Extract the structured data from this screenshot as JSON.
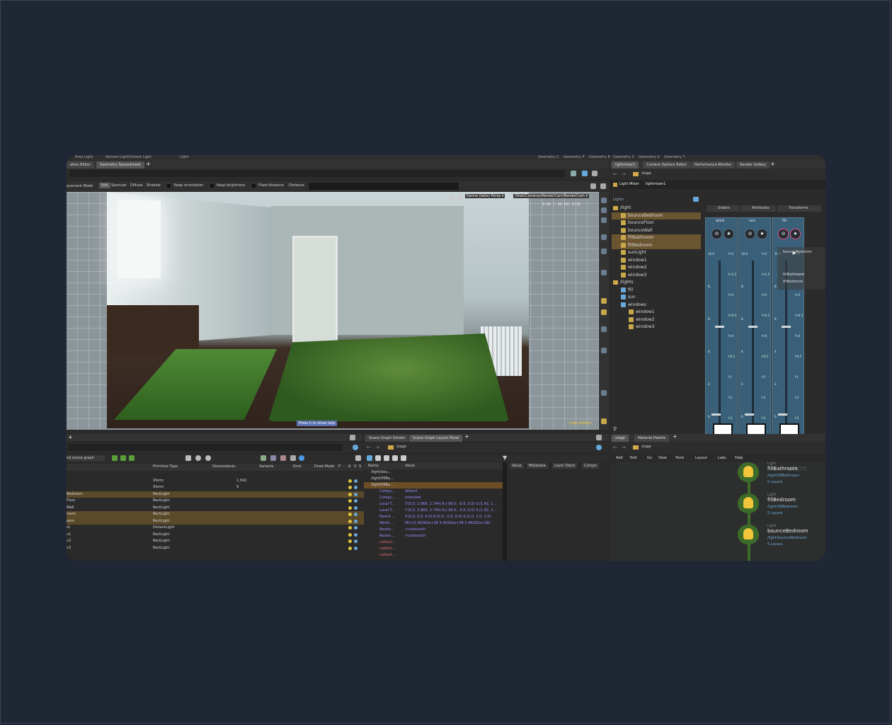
{
  "top_tabs": {
    "left_row": [
      "Area Light",
      "Volume Light",
      "Distant Light",
      "Light"
    ],
    "right_row": [
      "Geometry C",
      "Geometry P",
      "Geometry R",
      "Geometry S",
      "Geometry S",
      "Geometry T"
    ]
  },
  "pane_tabs_left": [
    "ation Editor",
    "Geometry Spreadsheet"
  ],
  "pane_tabs_right": [
    "lightmixer1",
    "Content Options Editor",
    "Performance Monitor",
    "Render Gallery"
  ],
  "viewport": {
    "mode_label": "acement Mode",
    "buttons": [
      "Edit",
      "Specular",
      "Diffuse",
      "Shadow"
    ],
    "checks": [
      "Keep orientation",
      "Keep brightness",
      "Fixed distance",
      "Distance"
    ],
    "renderer": "Karma (beta) Persp ▾",
    "camera_path": "/Shot/Cameras/RenderCam/RenderCam ▾",
    "stats": "0.8%   (-34:19)   0:16",
    "help_hint": "Press h to show help",
    "edition": "Indie Edition"
  },
  "light_mixer": {
    "path": "stage",
    "header": "Light Mixer",
    "node_name": "lightmixer1",
    "lights_label": "Lights",
    "tabs": [
      "Sliders",
      "Attributes",
      "Transforms"
    ],
    "tree": [
      {
        "label": "/light",
        "type": "folder",
        "level": 0
      },
      {
        "label": "bounceBedroom",
        "type": "light",
        "level": 1,
        "selected": true
      },
      {
        "label": "bounceFloor",
        "type": "light",
        "level": 1
      },
      {
        "label": "bounceWall",
        "type": "light",
        "level": 1
      },
      {
        "label": "fillBathroom",
        "type": "light",
        "level": 1,
        "selected": true
      },
      {
        "label": "fillBedroom",
        "type": "light",
        "level": 1,
        "selected": true
      },
      {
        "label": "sunLight",
        "type": "light",
        "level": 1
      },
      {
        "label": "window1",
        "type": "light",
        "level": 1
      },
      {
        "label": "window2",
        "type": "light",
        "level": 1
      },
      {
        "label": "window3",
        "type": "light",
        "level": 1
      },
      {
        "label": "/lights",
        "type": "folder",
        "level": 0
      },
      {
        "label": "fill",
        "type": "group",
        "level": 1
      },
      {
        "label": "sun",
        "type": "group",
        "level": 1
      },
      {
        "label": "windows",
        "type": "group",
        "level": 1
      },
      {
        "label": "window1",
        "type": "light",
        "level": 2
      },
      {
        "label": "window2",
        "type": "light",
        "level": 2
      },
      {
        "label": "window3",
        "type": "light",
        "level": 2
      }
    ],
    "strips": [
      {
        "name": "wind",
        "level": 0.6
      },
      {
        "name": "sun",
        "level": 0.6
      },
      {
        "name": "fill",
        "level": 0.6
      }
    ],
    "strip_scale": [
      "10.0",
      "8.",
      "6.",
      "4.",
      "2.",
      "0."
    ],
    "strip_scale_right": [
      "f+2",
      "f+1.5",
      "f+1",
      "f+0.5",
      "f+0",
      "f-0.5",
      "f-1",
      "f-2",
      "f-3"
    ],
    "drag_items": [
      "bounceBedroom",
      "fillBathroom",
      "fillBedroom"
    ]
  },
  "spreadsheet": {
    "filter": "nd scene graph",
    "columns": [
      "Primitive Type",
      "Descendants",
      "Variants",
      "Kind",
      "Draw Mode",
      "P",
      "A",
      "V",
      "S"
    ],
    "rows": [
      {
        "name": "",
        "type": "",
        "desc": "",
        "hi": false
      },
      {
        "name": "",
        "type": "Xform",
        "desc": "1,542",
        "hi": false
      },
      {
        "name": "",
        "type": "Xform",
        "desc": "9",
        "hi": false
      },
      {
        "name": "Bedroom",
        "type": "RectLight",
        "desc": "",
        "hi": true
      },
      {
        "name": "Floor",
        "type": "RectLight",
        "desc": "",
        "hi": false
      },
      {
        "name": "Wall",
        "type": "RectLight",
        "desc": "",
        "hi": false
      },
      {
        "name": "room",
        "type": "RectLight",
        "desc": "",
        "hi": true
      },
      {
        "name": "oom",
        "type": "RectLight",
        "desc": "",
        "hi": true
      },
      {
        "name": "nt",
        "type": "DistantLight",
        "desc": "",
        "hi": false
      },
      {
        "name": "v1",
        "type": "RectLight",
        "desc": "",
        "hi": false
      },
      {
        "name": "v2",
        "type": "RectLight",
        "desc": "",
        "hi": false
      },
      {
        "name": "v3",
        "type": "RectLight",
        "desc": "",
        "hi": false
      }
    ]
  },
  "scene_graph": {
    "tabs": [
      "Scene Graph Details",
      "Scene Graph Layers Panel"
    ],
    "path": "stage",
    "columns": [
      "Name",
      "Value"
    ],
    "side_tabs": [
      "Value",
      "Metadata",
      "Layer Stack",
      "Compo"
    ],
    "rows": [
      {
        "name": "/light/bou...",
        "value": "",
        "hi": false,
        "color": "#d5d5d5"
      },
      {
        "name": "/light/fillBa...",
        "value": "",
        "hi": false,
        "color": "#d5d5d5"
      },
      {
        "name": "/light/fillBa...",
        "value": "",
        "hi": true,
        "color": "#d5d5d5"
      },
      {
        "name": "Compu...",
        "value": "default",
        "hi": false,
        "color": "#9a8cff"
      },
      {
        "name": "Compu...",
        "value": "inherited",
        "hi": false,
        "color": "#9a8cff"
      },
      {
        "name": "Local T...",
        "value": "T:(0.0, 2.969, 2.744) R:(-90.0, -0.0, 0.0) S:(1.42, 1...",
        "hi": false,
        "color": "#9a8cff"
      },
      {
        "name": "Local T...",
        "value": "T:(0.0, 2.969, 2.744) R:(-90.0, -0.0, 0.0) S:(1.42, 1...",
        "hi": false,
        "color": "#9a8cff"
      },
      {
        "name": "Parent ...",
        "value": "T:(0.0, 0.0, 0.0) R:(0.0, -0.0, 0.0) S:(1.0, 1.0, 1.0)",
        "hi": false,
        "color": "#9a8cff"
      },
      {
        "name": "World ...",
        "value": "Min:(3.40282e+38 3.40282e+38 3.40282e+38)",
        "hi": false,
        "color": "#9a8cff"
      },
      {
        "name": "Resolv...",
        "value": "<unbound>",
        "hi": false,
        "color": "#9a8cff"
      },
      {
        "name": "Resolv...",
        "value": "<unbound>",
        "hi": false,
        "color": "#9a8cff"
      },
      {
        "name": "collecti...",
        "value": "",
        "hi": false,
        "color": "#e06a6a"
      },
      {
        "name": "collecti...",
        "value": "",
        "hi": false,
        "color": "#e06a6a"
      },
      {
        "name": "collecti...",
        "value": "",
        "hi": false,
        "color": "#e06a6a"
      }
    ]
  },
  "network": {
    "tabs": [
      "stage",
      "Material Palette"
    ],
    "path": "stage",
    "menu": [
      "Add",
      "Edit",
      "Go",
      "View",
      "Tools",
      "Layout",
      "Labs",
      "Help"
    ],
    "watermark": "ation",
    "nodes": [
      {
        "type": "Light",
        "name": "fillBathroom",
        "path": "/light/fillBathroom",
        "layers": "5 Layers"
      },
      {
        "type": "Light",
        "name": "fillBedroom",
        "path": "/light/fillBedroom",
        "layers": "5 Layers"
      },
      {
        "type": "Light",
        "name": "bounceBedroom",
        "path": "/light/bounceBedroom",
        "layers": "5 Layers"
      }
    ]
  },
  "colors": {
    "accent": "#f2c53a",
    "selection": "#6b5530",
    "strip": "#3a5f78",
    "node": "#3d6b2a"
  }
}
